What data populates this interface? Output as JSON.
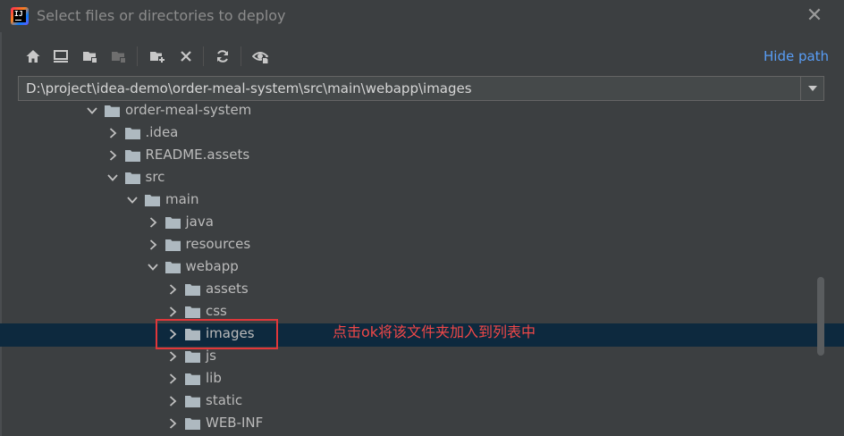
{
  "window": {
    "title": "Select files or directories to deploy",
    "app_icon": "intellij-idea-icon",
    "close_icon": "close-icon",
    "close_symbol": "✕"
  },
  "toolbar": {
    "buttons": [
      {
        "name": "home-icon",
        "tooltip": ""
      },
      {
        "name": "desktop-icon",
        "tooltip": ""
      },
      {
        "name": "project-folder-icon",
        "tooltip": ""
      },
      {
        "name": "module-folder-icon",
        "tooltip": ""
      },
      {
        "name": "new-folder-icon",
        "tooltip": ""
      },
      {
        "name": "delete-icon",
        "tooltip": ""
      },
      {
        "name": "refresh-icon",
        "tooltip": ""
      },
      {
        "name": "show-hidden-icon",
        "tooltip": ""
      }
    ],
    "hide_path_label": "Hide path"
  },
  "path_field": {
    "value": "D:\\project\\idea-demo\\order-meal-system\\src\\main\\webapp\\images",
    "dropdown_icon": "chevron-down-icon"
  },
  "tree": {
    "rows": [
      {
        "label": "order-meal-system",
        "depth": 0,
        "expanded": true,
        "selected": false
      },
      {
        "label": ".idea",
        "depth": 1,
        "expanded": false,
        "selected": false
      },
      {
        "label": "README.assets",
        "depth": 1,
        "expanded": false,
        "selected": false
      },
      {
        "label": "src",
        "depth": 1,
        "expanded": true,
        "selected": false
      },
      {
        "label": "main",
        "depth": 2,
        "expanded": true,
        "selected": false
      },
      {
        "label": "java",
        "depth": 3,
        "expanded": false,
        "selected": false
      },
      {
        "label": "resources",
        "depth": 3,
        "expanded": false,
        "selected": false
      },
      {
        "label": "webapp",
        "depth": 3,
        "expanded": true,
        "selected": false
      },
      {
        "label": "assets",
        "depth": 4,
        "expanded": false,
        "selected": false
      },
      {
        "label": "css",
        "depth": 4,
        "expanded": false,
        "selected": false
      },
      {
        "label": "images",
        "depth": 4,
        "expanded": false,
        "selected": true
      },
      {
        "label": "js",
        "depth": 4,
        "expanded": false,
        "selected": false
      },
      {
        "label": "lib",
        "depth": 4,
        "expanded": false,
        "selected": false
      },
      {
        "label": "static",
        "depth": 4,
        "expanded": false,
        "selected": false
      },
      {
        "label": "WEB-INF",
        "depth": 4,
        "expanded": false,
        "selected": false
      }
    ]
  },
  "annotation": {
    "text": "点击ok将该文件夹加入到列表中",
    "color": "#f04848"
  },
  "colors": {
    "background": "#3c3f41",
    "selection": "#0d293e",
    "link": "#589df6",
    "folder": "#aeb9c0",
    "highlight_border": "#e0373a"
  }
}
